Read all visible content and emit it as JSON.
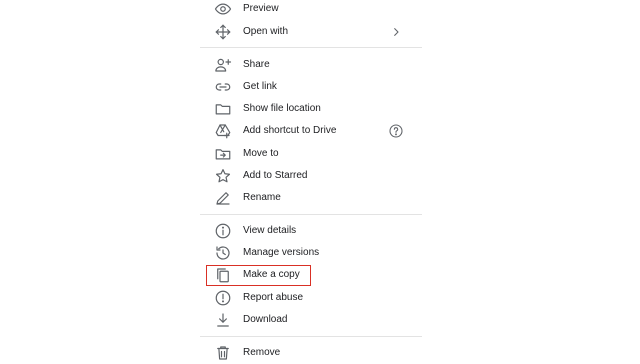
{
  "menu": {
    "items": [
      {
        "id": "preview",
        "label": "Preview",
        "icon": "eye-icon"
      },
      {
        "id": "open-with",
        "label": "Open with",
        "icon": "move-arrows-icon",
        "trailing": "chevron-right-icon",
        "trailing_glyph": ">"
      },
      {
        "id": "share",
        "label": "Share",
        "icon": "person-add-icon"
      },
      {
        "id": "get-link",
        "label": "Get link",
        "icon": "link-icon"
      },
      {
        "id": "show-file-location",
        "label": "Show file location",
        "icon": "folder-icon"
      },
      {
        "id": "add-shortcut",
        "label": "Add shortcut to Drive",
        "icon": "drive-add-icon",
        "trailing": "help-circle-icon"
      },
      {
        "id": "move-to",
        "label": "Move to",
        "icon": "folder-move-icon"
      },
      {
        "id": "add-to-starred",
        "label": "Add to Starred",
        "icon": "star-icon"
      },
      {
        "id": "rename",
        "label": "Rename",
        "icon": "pencil-icon"
      },
      {
        "id": "view-details",
        "label": "View details",
        "icon": "info-icon"
      },
      {
        "id": "manage-versions",
        "label": "Manage versions",
        "icon": "history-icon"
      },
      {
        "id": "make-a-copy",
        "label": "Make a copy",
        "icon": "copy-icon",
        "highlighted": true
      },
      {
        "id": "report-abuse",
        "label": "Report abuse",
        "icon": "report-icon"
      },
      {
        "id": "download",
        "label": "Download",
        "icon": "download-icon"
      },
      {
        "id": "remove",
        "label": "Remove",
        "icon": "trash-icon"
      }
    ]
  },
  "colors": {
    "highlight_border": "#d93025",
    "icon": "#5f6368",
    "text": "#202124",
    "divider": "#e3e3e3"
  }
}
